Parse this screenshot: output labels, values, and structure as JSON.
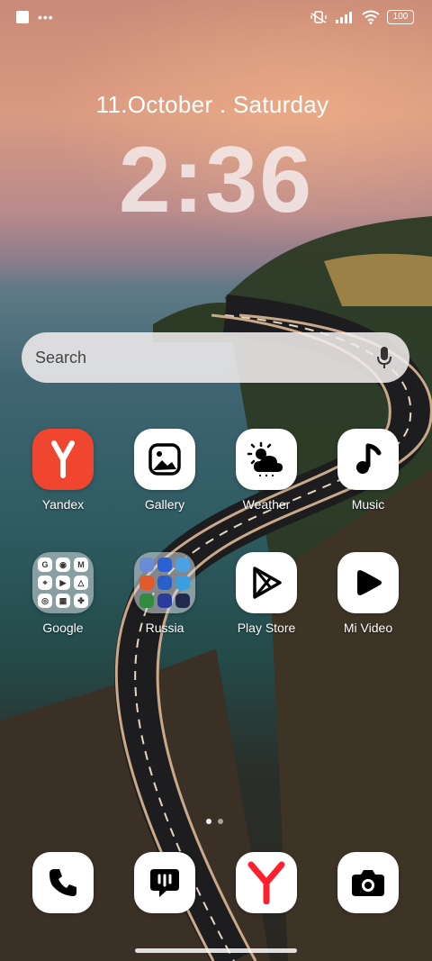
{
  "status_bar": {
    "left_icons": [
      "notification-square-icon",
      "more-dots-icon"
    ],
    "more_dots": "•••",
    "right_icons": [
      "vibrate-off-icon",
      "signal-icon",
      "wifi-icon",
      "battery-icon"
    ],
    "battery": "100"
  },
  "lockscreen": {
    "date": "11.October . Saturday",
    "time": "2:36"
  },
  "search": {
    "placeholder": "Search",
    "icon": "mic-icon"
  },
  "apps": [
    {
      "label": "Yandex",
      "icon": "yandex-icon",
      "color": "#f0452f"
    },
    {
      "label": "Gallery",
      "icon": "gallery-icon"
    },
    {
      "label": "Weather",
      "icon": "weather-icon"
    },
    {
      "label": "Music",
      "icon": "music-note-icon"
    },
    {
      "label": "Google",
      "icon": "google-folder-icon",
      "folder": true,
      "letters": [
        "G",
        "◉",
        "M",
        "⌖",
        "▶",
        "△",
        "◎",
        "▦",
        "✤"
      ]
    },
    {
      "label": "Russia",
      "icon": "russia-folder-icon",
      "folder": true
    },
    {
      "label": "Play Store",
      "icon": "play-store-icon"
    },
    {
      "label": "Mi Video",
      "icon": "play-icon"
    }
  ],
  "pager": {
    "count": 2,
    "active": 0
  },
  "dock": [
    {
      "icon": "phone-icon"
    },
    {
      "icon": "messages-icon"
    },
    {
      "icon": "yandex-browser-icon",
      "color": "#ff1f2d"
    },
    {
      "icon": "camera-icon"
    }
  ]
}
